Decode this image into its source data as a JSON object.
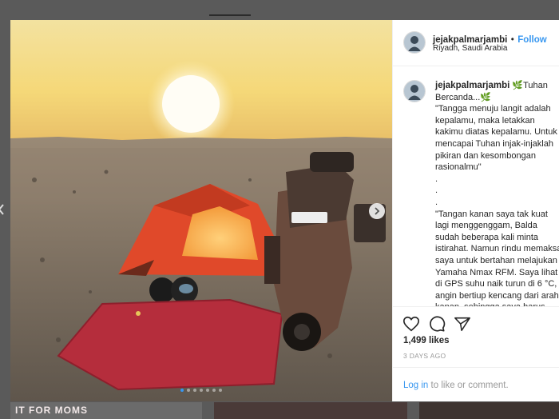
{
  "header": {
    "username": "jejakpalmarjambi",
    "separator": "•",
    "follow_label": "Follow",
    "location": "Riyadh, Saudi Arabia"
  },
  "caption": {
    "username": "jejakpalmarjambi",
    "text": "🌿Tuhan Bercanda...🌿\n\"Tangga menuju langit adalah kepalamu, maka letakkan kakimu diatas kepalamu. Untuk mencapai Tuhan injak-injaklah pikiran dan kesombongan rasionalmu\"\n.\n.\n.\n\"Tangan kanan saya tak kuat lagi menggenggam, Balda sudah beberapa kali minta istirahat. Namun rindu memaksa saya untuk bertahan melajukan Yamaha Nmax RFM. Saya lihat di GPS suhu naik turun di 6 °C, angin bertiup kencang dari arah kanan, sehingga saya harus memiringkan motor beberapa derajat ke kanan agar tetap balance. Beberapa Truck"
  },
  "actions": {
    "like_icon": "heart-icon",
    "comment_icon": "comment-icon",
    "share_icon": "share-icon"
  },
  "likes": "1,499 likes",
  "time_ago": "3 DAYS AGO",
  "login": {
    "link_label": "Log in",
    "rest_text": "to like or comment."
  },
  "carousel": {
    "count": 7,
    "active_index": 0
  },
  "bottom_strip_text": "IT FOR MOMS",
  "colors": {
    "link": "#3897f0",
    "text": "#262626",
    "muted": "#999999"
  }
}
